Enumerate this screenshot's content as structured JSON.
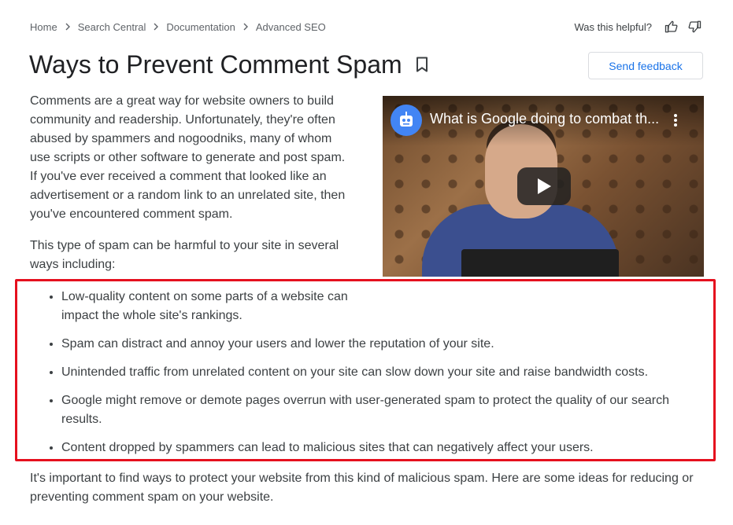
{
  "breadcrumb": {
    "items": [
      "Home",
      "Search Central",
      "Documentation",
      "Advanced SEO"
    ]
  },
  "helpful": {
    "label": "Was this helpful?"
  },
  "page": {
    "title": "Ways to Prevent Comment Spam",
    "feedback_label": "Send feedback"
  },
  "content": {
    "intro": "Comments are a great way for website owners to build community and readership. Unfortunately, they're often abused by spammers and nogoodniks, many of whom use scripts or other software to generate and post spam. If you've ever received a comment that looked like an advertisement or a random link to an unrelated site, then you've encountered comment spam.",
    "intro2": "This type of spam can be harmful to your site in several ways including:",
    "bullets": [
      "Low-quality content on some parts of a website can impact the whole site's rankings.",
      "Spam can distract and annoy your users and lower the reputation of your site.",
      "Unintended traffic from unrelated content on your site can slow down your site and raise bandwidth costs.",
      "Google might remove or demote pages overrun with user-generated spam to protect the quality of our search results.",
      "Content dropped by spammers can lead to malicious sites that can negatively affect your users."
    ],
    "outro": "It's important to find ways to protect your website from this kind of malicious spam. Here are some ideas for reducing or preventing comment spam on your website."
  },
  "video": {
    "title": "What is Google doing to combat th...",
    "icons": [
      "channel-avatar",
      "more-vert-icon",
      "play-icon"
    ]
  },
  "colors": {
    "accent": "#1a73e8",
    "highlight_border": "#e5101e",
    "text": "#3c4043"
  }
}
